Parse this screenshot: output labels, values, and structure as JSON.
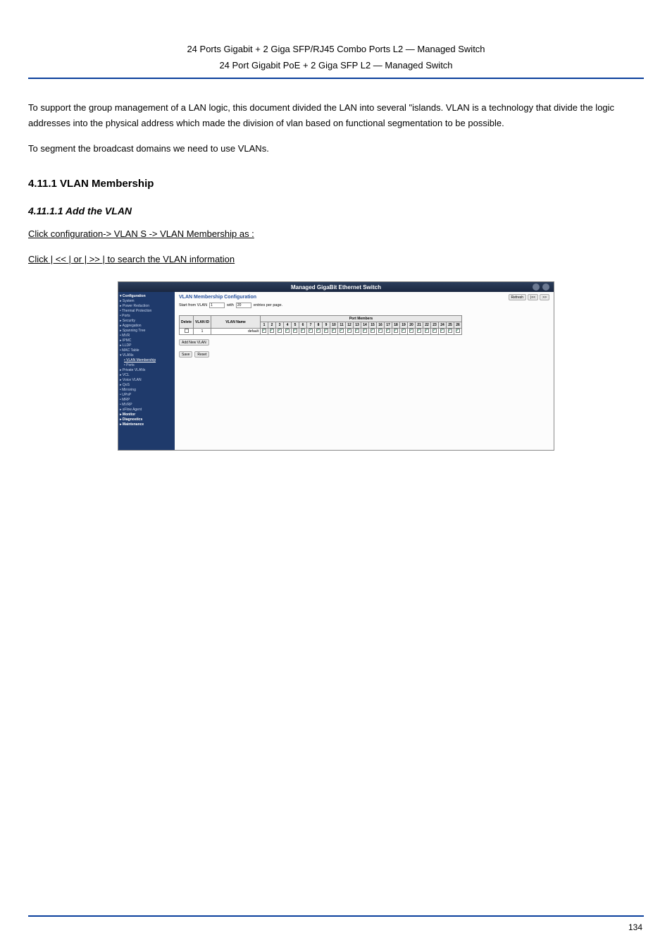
{
  "header": {
    "line1_a": "24 Ports Gigabit + 2 Giga SFP/RJ45 Combo Ports L2 ",
    "line1_b": "Managed Switch",
    "line2_a": "24 Port Gigabit PoE + 2 Giga SFP L2 ",
    "line2_b": "Managed Switch"
  },
  "intro": {
    "p1": "To support the group management of a LAN logic, this document divided the LAN into several \"islands. VLAN is a technology that divide the logic addresses into the physical address which made the division of vlan based on functional segmentation to be possible.",
    "p2": "To segment the broadcast domains we need to use VLANs."
  },
  "section": "4.11.1 VLAN Membership",
  "subsection": "4.11.1.1 Add the VLAN",
  "steps": {
    "s1": "Click configuration-> VLAN S -> VLAN Membership as :",
    "s2": "Click | << | or | >> | to search the VLAN information"
  },
  "shot": {
    "top_title": "Managed GigaBit Ethernet Switch",
    "sidebar": {
      "header": "▾ Configuration",
      "items": [
        "▸ System",
        "▸ Power Reduction",
        "• Thermal Protection",
        "• Ports",
        "▸ Security",
        "▸ Aggregation",
        "▸ Spanning Tree",
        "• MVR",
        "▸ IPMC",
        "▸ LLDP",
        "• MAC Table",
        "▾ VLANs"
      ],
      "vlan_sub_sel": "• VLAN Membership",
      "vlan_sub2": "• Ports",
      "items2": [
        "▸ Private VLANs",
        "▸ VCL",
        "▸ Voice VLAN",
        "▸ QoS",
        "• Mirroring",
        "• UPnP",
        "• MRP",
        "• MVRP",
        "▸ sFlow Agent"
      ],
      "footer": [
        "▸ Monitor",
        "▸ Diagnostics",
        "▸ Maintenance"
      ]
    },
    "main": {
      "title": "VLAN Membership Configuration",
      "start_label_a": "Start from VLAN",
      "start_val": "1",
      "start_label_b": "with",
      "perpage_val": "20",
      "start_label_c": "entries per page.",
      "refresh": "Refresh",
      "prev": "|<<",
      "next": ">>",
      "col_delete": "Delete",
      "col_vid": "VLAN ID",
      "col_vname": "VLAN Name",
      "col_ports": "Port Members",
      "ports": [
        "1",
        "2",
        "3",
        "4",
        "5",
        "6",
        "7",
        "8",
        "9",
        "10",
        "11",
        "12",
        "13",
        "14",
        "15",
        "16",
        "17",
        "18",
        "19",
        "20",
        "21",
        "22",
        "23",
        "24",
        "25",
        "26"
      ],
      "row_vid": "1",
      "row_vname": "default",
      "add_btn": "Add New VLAN",
      "save": "Save",
      "reset": "Reset"
    }
  },
  "footer": {
    "page": "134"
  }
}
